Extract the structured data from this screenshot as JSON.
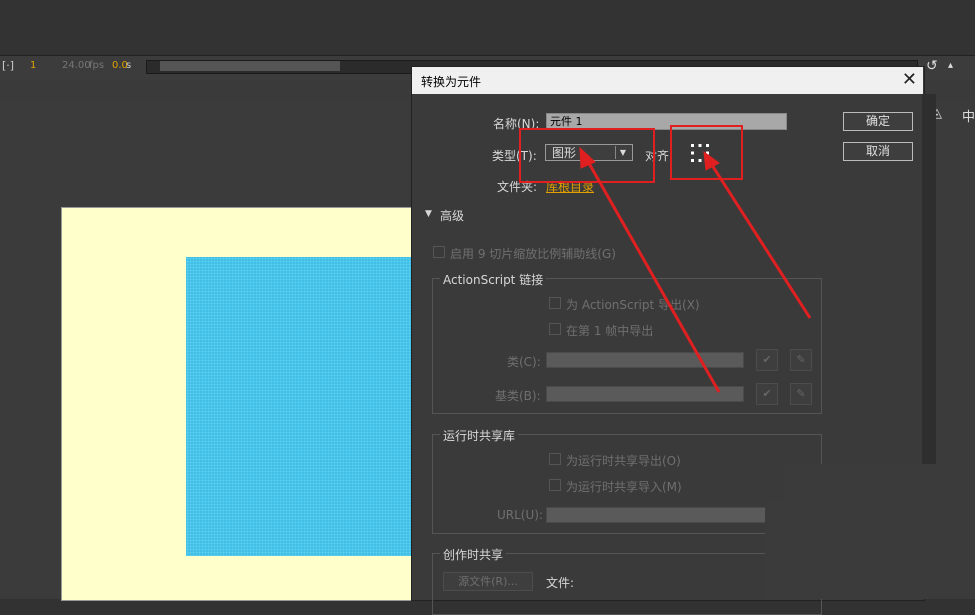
{
  "timeline": {
    "frame": "1",
    "fps": "24.00",
    "fps_unit": "fps",
    "time": "0.0",
    "time_unit": "s"
  },
  "dialog": {
    "title": "转换为元件",
    "name_label": "名称(N):",
    "name_value": "元件 1",
    "type_label": "类型(T):",
    "type_value": "图形",
    "align_label": "对齐",
    "folder_label": "文件夹:",
    "folder_value": "库根目录",
    "ok_label": "确定",
    "cancel_label": "取消",
    "advanced_label": "高级",
    "nine_slice_label": "启用 9 切片缩放比例辅助线(G)",
    "actionscript_group": "ActionScript 链接",
    "export_as_label": "为 ActionScript 导出(X)",
    "export_frame1_label": "在第 1 帧中导出",
    "class_label": "类(C):",
    "base_class_label": "基类(B):",
    "runtime_group": "运行时共享库",
    "runtime_export_label": "为运行时共享导出(O)",
    "runtime_import_label": "为运行时共享导入(M)",
    "url_label": "URL(U):",
    "authoring_group": "创作时共享",
    "source_file_button": "源文件(R)...",
    "file_label": "文件:"
  },
  "colors": {
    "stage": "#ffffcc",
    "shape": "#3fbfe6",
    "annotation": "#e02020",
    "accent_orange": "#e0a000"
  },
  "icons": [
    "fit-icon",
    "rotate-icon",
    "align-icon",
    "check-icon",
    "pencil-icon",
    "close-icon"
  ]
}
